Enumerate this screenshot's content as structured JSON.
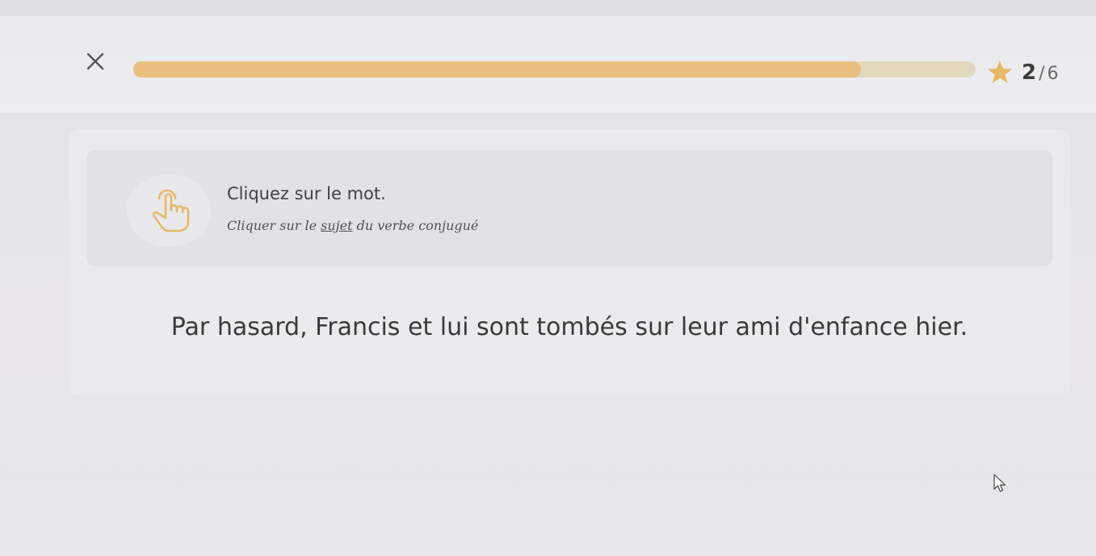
{
  "header": {
    "close_icon": "close-icon",
    "progress": {
      "fraction": 0.864
    },
    "star_icon": "star-icon",
    "star_color": "#e8b866",
    "step": {
      "current": "2",
      "separator": "/",
      "total": "6"
    }
  },
  "instruction": {
    "icon": "tap-hand-icon",
    "icon_color": "#e8b866",
    "title": "Cliquez sur le mot.",
    "subtitle_prefix": "Cliquer sur le ",
    "subtitle_emphasis": "sujet",
    "subtitle_suffix": " du verbe conjugué"
  },
  "sentence": {
    "words": [
      "Par",
      "hasard,",
      "Francis",
      "et",
      "lui",
      "sont",
      "tombés",
      "sur",
      "leur",
      "ami",
      "d'enfance",
      "hier."
    ]
  },
  "colors": {
    "accent": "#e9bf7f",
    "track": "#e2d8bd"
  }
}
